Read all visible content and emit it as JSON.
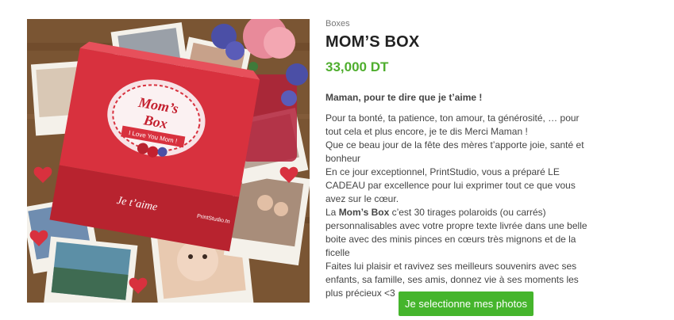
{
  "product": {
    "category": "Boxes",
    "title": "MOM’S BOX",
    "price": "33,000 DT",
    "lead": "Maman, pour te dire que je t’aime !",
    "paragraphs": [
      "Pour ta bonté, ta patience, ton amour, ta générosité, … pour tout cela et plus encore, je te dis Merci Maman !",
      "Que ce beau jour de la fête des mères t’apporte joie, santé et bonheur",
      "En ce jour exceptionnel, PrintStudio, vous a préparé LE CADEAU par excellence pour lui exprimer tout ce que vous avez sur le cœur."
    ],
    "highlight_prefix": "La ",
    "highlight_bold": "Mom’s Box",
    "highlight_rest": " c’est 30 tirages polaroids (ou carrés) personnalisables avec votre propre texte livrée dans une belle boite avec des minis pinces en cœurs très mignons et de la ficelle",
    "closing": "Faites lui plaisir et ravivez ses meilleurs souvenirs avec ses enfants, sa famille, ses amis, donnez vie à ses moments les plus précieux <3",
    "cta_label": "Je selectionne mes photos"
  },
  "image": {
    "box_label_top": "Mom’s",
    "box_label_bottom": "Box",
    "ribbon_text": "I Love You Mom !",
    "box_side_text": "Je t’aime",
    "box_brand": "PrintStudio.tn"
  },
  "colors": {
    "price": "#4fae2e",
    "button": "#45b52c",
    "box_red": "#d8313e"
  }
}
